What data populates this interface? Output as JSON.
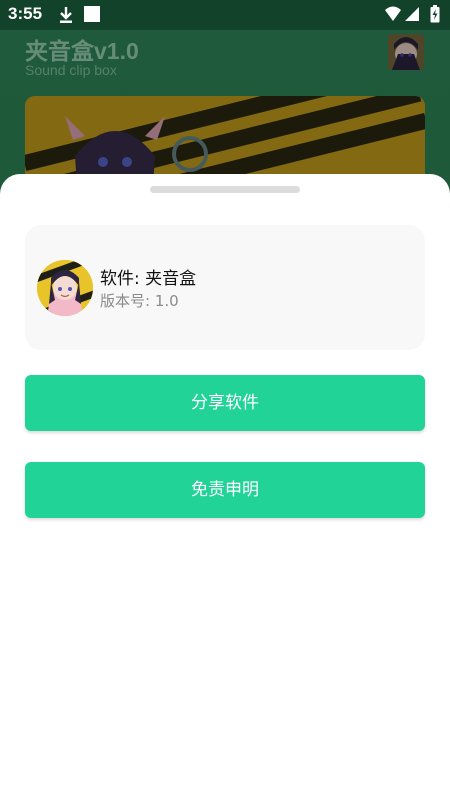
{
  "status_bar": {
    "time": "3:55",
    "icons": [
      "download-icon",
      "square-notification-icon",
      "wifi-icon",
      "signal-icon",
      "battery-charging-icon"
    ]
  },
  "background_app": {
    "title": "夹音盒v1.0",
    "subtitle": "Sound clip box",
    "banner_image": "anime-girl-banner-image",
    "avatar_image": "anime-girl-avatar-image"
  },
  "sheet": {
    "app_name": "软件: 夹音盒",
    "version": "版本号: 1.0",
    "share_button_label": "分享软件",
    "disclaimer_button_label": "免责申明"
  },
  "colors": {
    "accent": "#22d398",
    "sheet_background": "#ffffff",
    "card_background": "#f8f8f8",
    "app_background": "#2f8a5b"
  }
}
